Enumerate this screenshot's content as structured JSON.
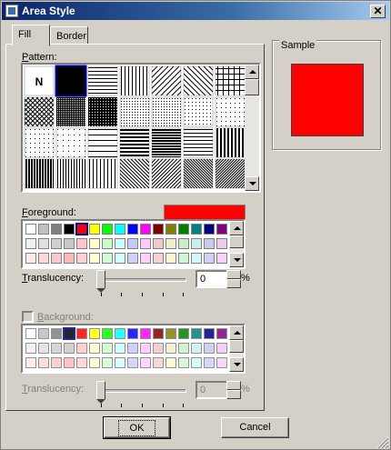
{
  "window": {
    "title": "Area Style",
    "close_label": "✕"
  },
  "tabs": [
    {
      "label": "Fill",
      "active": true
    },
    {
      "label": "Border",
      "active": false
    }
  ],
  "pattern": {
    "label": "Pattern:",
    "first_tile_label": "N",
    "selected_index": 1
  },
  "foreground": {
    "label": "Foreground:",
    "color": "#ff0000"
  },
  "fg_translucency": {
    "label": "Translucency:",
    "value": "0",
    "unit": "%",
    "position": 0
  },
  "background": {
    "label": "Background:",
    "checked": false,
    "enabled": false
  },
  "bg_translucency": {
    "label": "Translucency:",
    "value": "0",
    "unit": "%",
    "position": 0,
    "enabled": false
  },
  "sample": {
    "label": "Sample",
    "color": "#ff0000"
  },
  "buttons": {
    "ok": "OK",
    "cancel": "Cancel"
  },
  "palette": {
    "base": [
      "#ffffff",
      "#c0c0c0",
      "#808080",
      "#000000",
      "#ff0000",
      "#ffff00",
      "#00ff00",
      "#00ffff",
      "#0000ff",
      "#ff00ff",
      "#800000",
      "#808000",
      "#008000",
      "#008080",
      "#000080",
      "#800080"
    ],
    "tint": [
      "#f0f0f0",
      "#e0e0e0",
      "#d0d0d0",
      "#c8c8c8",
      "#ffc8c8",
      "#ffffc8",
      "#c8ffc8",
      "#c8ffff",
      "#c8c8ff",
      "#ffc8ff",
      "#f0c8c8",
      "#f0f0c8",
      "#c8f0c8",
      "#c8f0f0",
      "#c8c8f0",
      "#f0c8f0"
    ],
    "tint2": [
      "#ffe8e8",
      "#ffd8d8",
      "#ffc8c8",
      "#ffb8b8",
      "#ffd0d0",
      "#ffffd0",
      "#d0ffd0",
      "#d0ffff",
      "#d0d0ff",
      "#ffd0ff",
      "#f8d0d0",
      "#f8f8d0",
      "#d0f8d0",
      "#d0f8f8",
      "#d0d0f8",
      "#f8d0f8"
    ],
    "fg_selected": 4,
    "bg_selected": 3
  }
}
